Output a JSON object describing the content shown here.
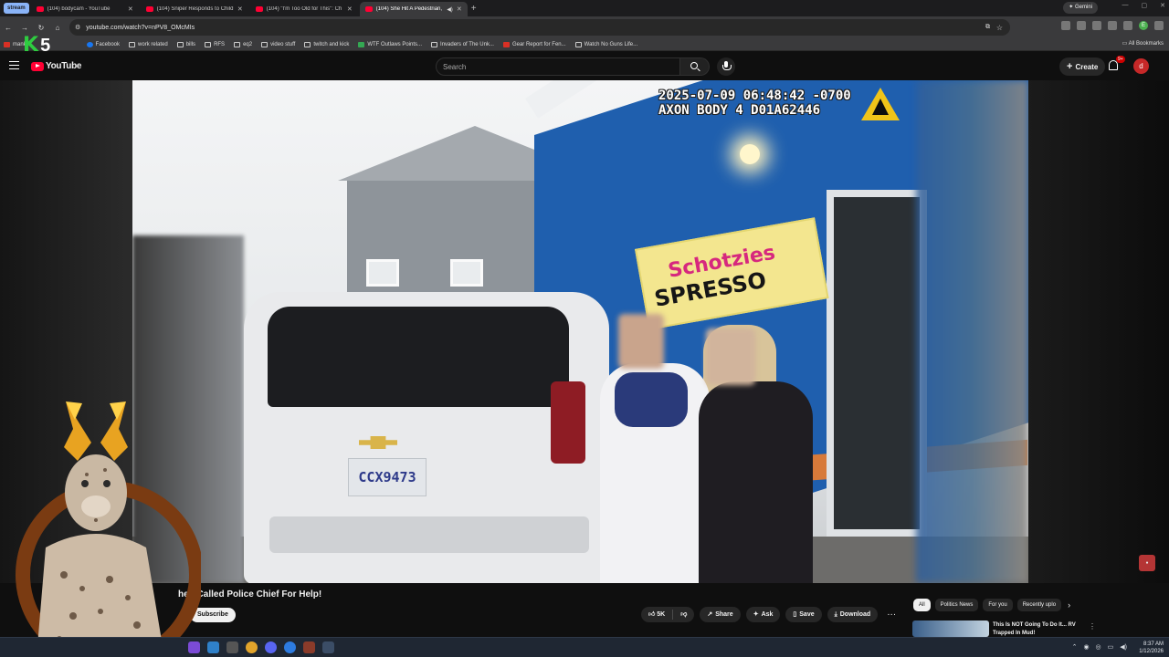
{
  "browser": {
    "tab_group_label": "stream",
    "tabs": [
      {
        "title": "(104) bodycam - YouTube",
        "active": false
      },
      {
        "title": "(104) Sniper Responds to Child",
        "active": false
      },
      {
        "title": "(104) \"I'm Too Old for This\": Ch",
        "active": false
      },
      {
        "title": "(104) She Hit A Pedestrian,",
        "active": true
      }
    ],
    "new_tab_glyph": "+",
    "gemini_label": "Gemini",
    "url": "youtube.com/watch?v=nPV8_OMcMIs",
    "bookmarks": [
      {
        "label": "mank",
        "icon": "folder-icon"
      },
      {
        "label": "Facebook",
        "icon": "facebook-icon"
      },
      {
        "label": "work related",
        "icon": "folder-icon"
      },
      {
        "label": "bills",
        "icon": "folder-icon"
      },
      {
        "label": "RFS",
        "icon": "folder-icon"
      },
      {
        "label": "eq2",
        "icon": "folder-icon"
      },
      {
        "label": "video stuff",
        "icon": "folder-icon"
      },
      {
        "label": "twitch and kick",
        "icon": "folder-icon"
      },
      {
        "label": "WTF Outlaws Points...",
        "icon": "green-icon"
      },
      {
        "label": "Invaders of The Unk...",
        "icon": "site-icon"
      },
      {
        "label": "Gear Report for Fen...",
        "icon": "site-icon"
      },
      {
        "label": "Watch No Guns Life...",
        "icon": "site-icon"
      }
    ],
    "all_bookmarks_label": "All Bookmarks"
  },
  "youtube": {
    "logo_text": "YouTube",
    "search_placeholder": "Search",
    "create_label": "Create",
    "notification_count": "9+",
    "avatar_initial": "d",
    "video": {
      "timestamp_line1": "2025-07-09 06:48:42 -0700",
      "timestamp_line2": "AXON BODY 4 D01A62446",
      "sign_line1": "Schotzies",
      "sign_line2": "SPRESSO",
      "plate": "CCX9473"
    },
    "title": "hen Called Police Chief For Help!",
    "subscribe_label": "Subscribe",
    "actions": {
      "like_count": "5K",
      "share": "Share",
      "ask": "Ask",
      "save": "Save",
      "download": "Download"
    },
    "chips": [
      "All",
      "Politics News",
      "For you",
      "Recently uplo"
    ],
    "recommendation_title": "This Is NOT Going To Do It... RV Trapped In Mud!"
  },
  "overlay": {
    "brand_k": "K",
    "brand_5": "5"
  },
  "taskbar": {
    "time": "8:37 AM",
    "date": "1/12/2026"
  }
}
